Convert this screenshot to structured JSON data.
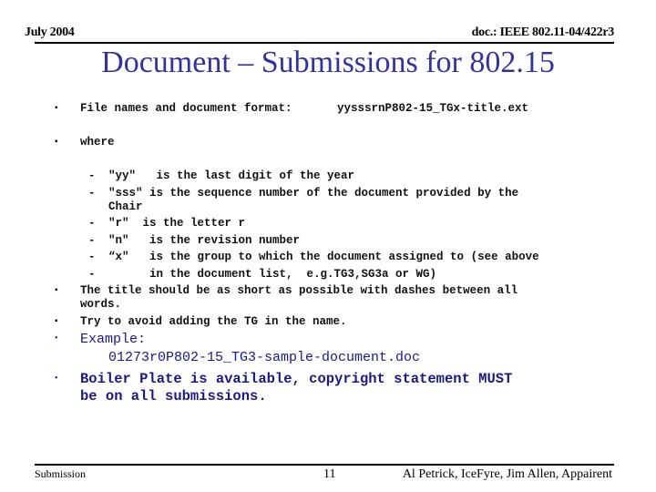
{
  "header": {
    "date": "July 2004",
    "doc_id": "doc.: IEEE 802.11-04/422r3"
  },
  "title": "Document – Submissions for 802.15",
  "body": {
    "bullet1_label": "File names and document format:",
    "bullet1_format": "yysssrnP802-15_TGx-title.ext",
    "bullet2": "where",
    "sub_items": [
      {
        "dash": "-",
        "text": "\"yy\"   is the last digit of the year"
      },
      {
        "dash": "-",
        "text": "\"sss\" is the sequence number of the document provided by the"
      },
      {
        "dash": "",
        "text": "Chair"
      },
      {
        "dash": "-",
        "text": "\"r\"  is the letter r"
      },
      {
        "dash": "-",
        "text": "\"n\"   is the revision number"
      },
      {
        "dash": "-",
        "text": "“x\"   is the group to which the document assigned to (see above"
      },
      {
        "dash": "-",
        "text": "      in the document list,  e.g.TG3,SG3a or WG)"
      }
    ],
    "bullet3_line1": "The title should be as short as possible with dashes between all",
    "bullet3_line2": "words.",
    "bullet4": "Try to avoid adding the TG in the name.",
    "example_label": "Example:",
    "example_value": "01273r0P802-15_TG3-sample-document.doc",
    "boiler_line1": "Boiler Plate is available, copyright statement MUST",
    "boiler_line2": "be on all submissions."
  },
  "footer": {
    "left": "Submission",
    "page": "11",
    "authors": "Al Petrick, IceFyre, Jim Allen, Appairent"
  },
  "colors": {
    "title": "#333399",
    "emphasis": "#1a1a80"
  }
}
